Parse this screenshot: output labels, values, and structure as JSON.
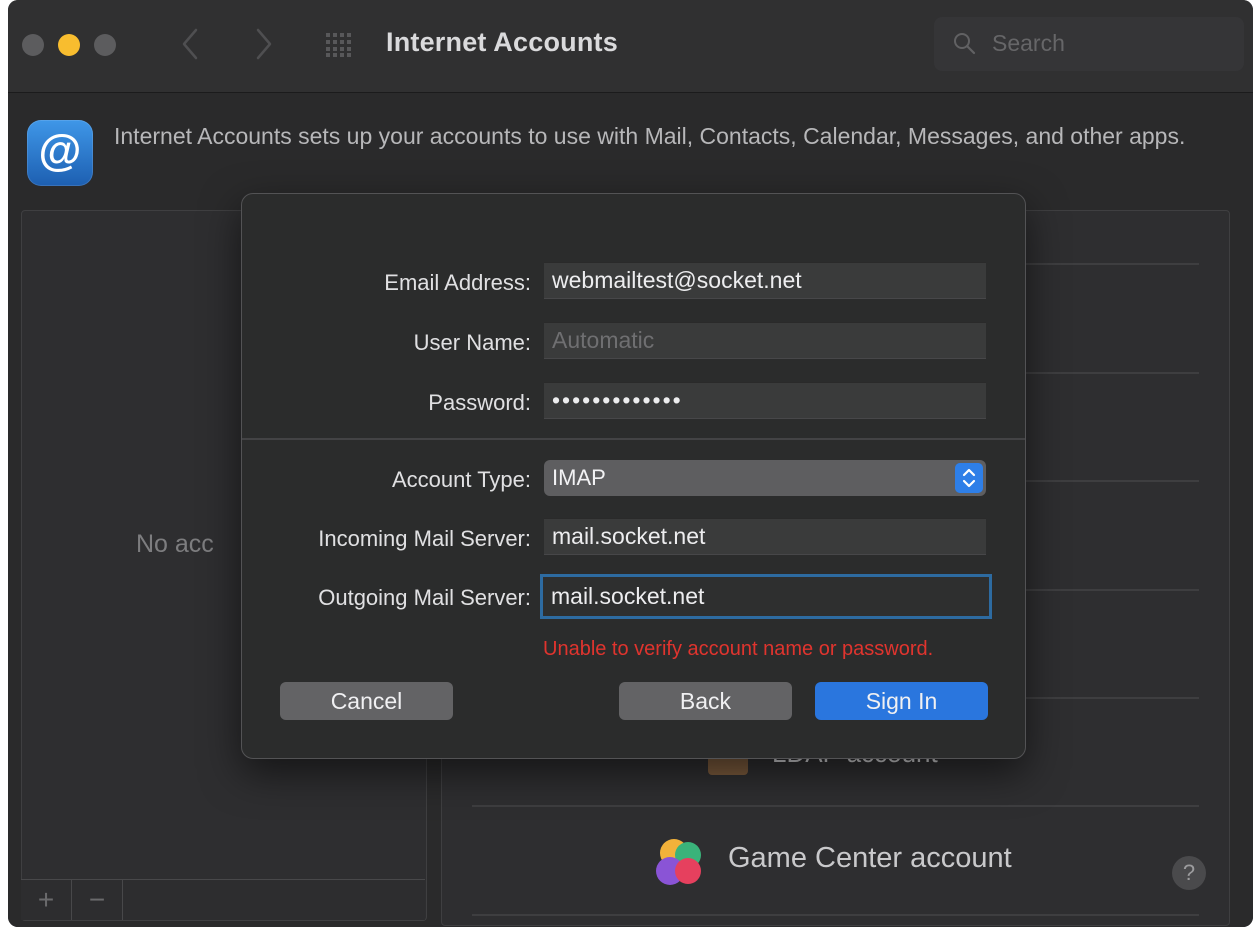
{
  "window": {
    "title": "Internet Accounts",
    "search_placeholder": "Search"
  },
  "header": {
    "description": "Internet Accounts sets up your accounts to use with Mail, Contacts, Calendar, Messages, and other apps."
  },
  "accounts_list": {
    "empty_text": "No acc",
    "add_label": "+",
    "remove_label": "−"
  },
  "providers": {
    "items": [
      {
        "label": "LDAP account",
        "icon": "ldap-icon"
      },
      {
        "label": "Game Center account",
        "icon": "game-center-icon"
      }
    ],
    "help_label": "?"
  },
  "sheet": {
    "email_label": "Email Address:",
    "email_value": "webmailtest@socket.net",
    "username_label": "User Name:",
    "username_placeholder": "Automatic",
    "password_label": "Password:",
    "password_value": "•••••••••••••",
    "account_type_label": "Account Type:",
    "account_type_value": "IMAP",
    "incoming_label": "Incoming Mail Server:",
    "incoming_value": "mail.socket.net",
    "outgoing_label": "Outgoing Mail Server:",
    "outgoing_value": "mail.socket.net",
    "error": "Unable to verify account name or password.",
    "cancel_label": "Cancel",
    "back_label": "Back",
    "signin_label": "Sign In"
  },
  "colors": {
    "accent": "#2a76de",
    "error": "#e0342e",
    "minimize": "#f8bd2f"
  }
}
